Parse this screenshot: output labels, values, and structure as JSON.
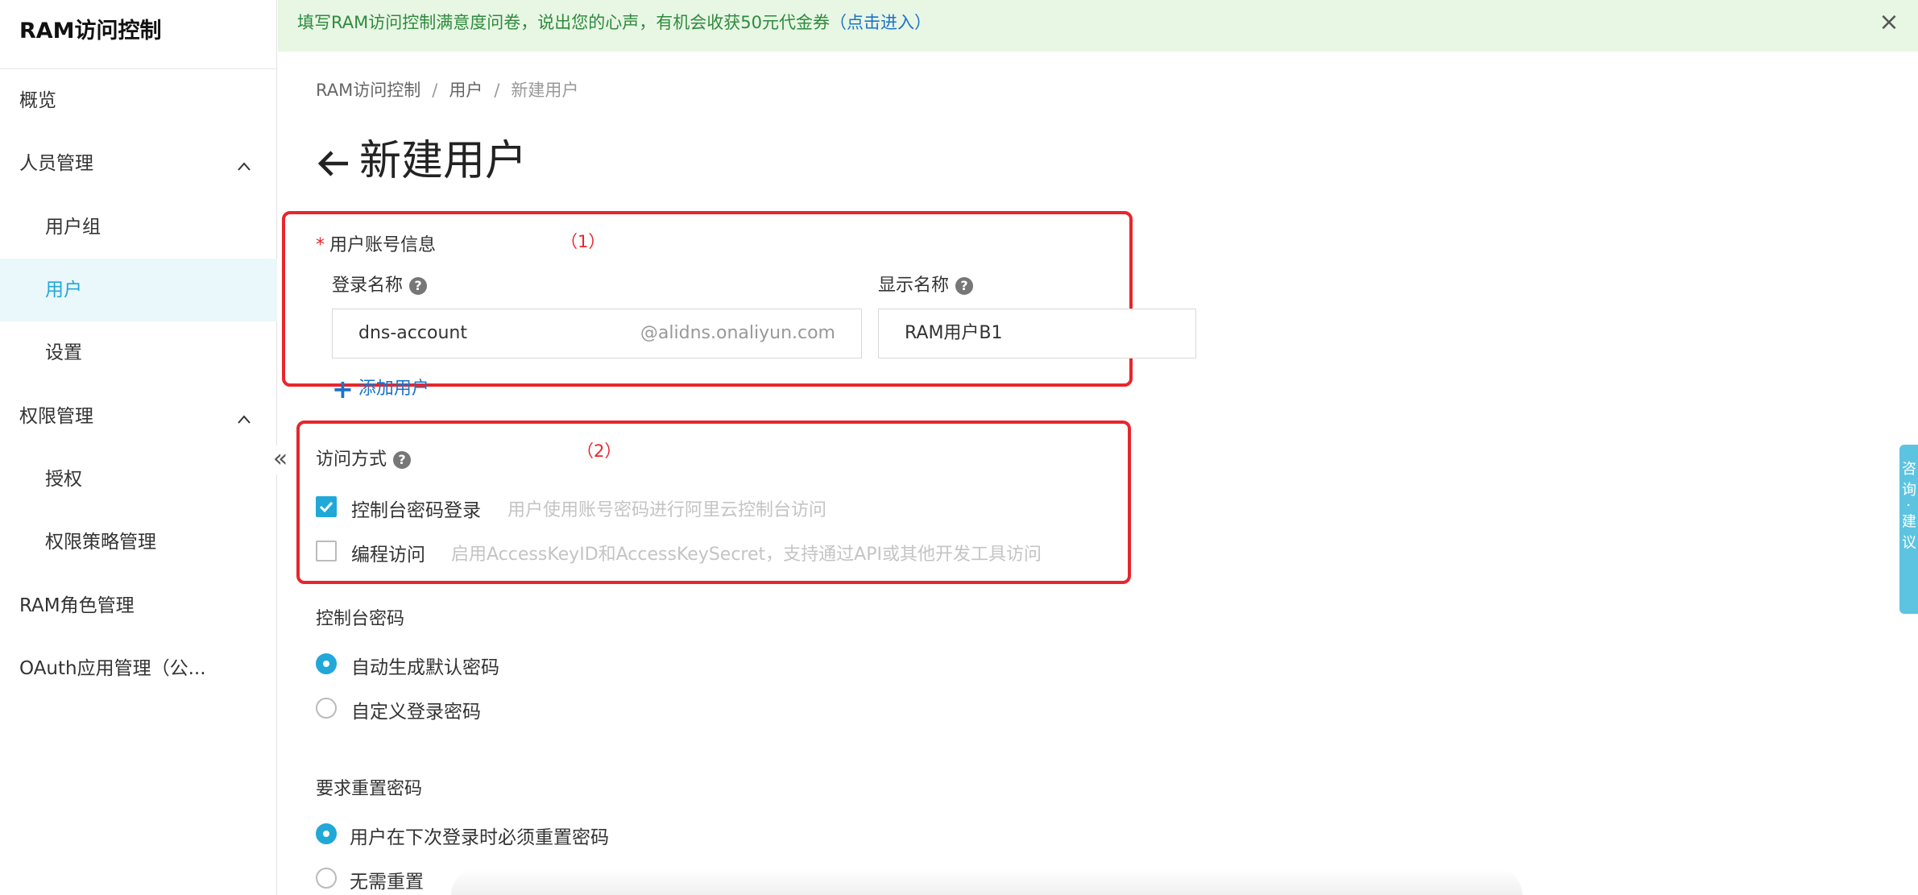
{
  "app": {
    "title": "RAM访问控制"
  },
  "sidebar": {
    "items": [
      {
        "label": "概览"
      },
      {
        "label": "人员管理"
      },
      {
        "label": "用户组"
      },
      {
        "label": "用户"
      },
      {
        "label": "设置"
      },
      {
        "label": "权限管理"
      },
      {
        "label": "授权"
      },
      {
        "label": "权限策略管理"
      },
      {
        "label": "RAM角色管理"
      },
      {
        "label": "OAuth应用管理（公..."
      }
    ],
    "collapse_glyph": "«"
  },
  "banner": {
    "text": "填写RAM访问控制满意度问卷，说出您的心声，有机会收获50元代金券",
    "link": "（点击进入）",
    "close": "×"
  },
  "breadcrumb": {
    "items": [
      "RAM访问控制",
      "用户",
      "新建用户"
    ],
    "sep": "/"
  },
  "page": {
    "title": "新建用户"
  },
  "account_info": {
    "label": "用户账号信息",
    "annotation": "（1）",
    "login_name_label": "登录名称",
    "display_name_label": "显示名称",
    "login_name_value": "dns-account",
    "login_name_suffix": "@alidns.onaliyun.com",
    "display_name_value": "RAM用户B1",
    "add_user": "添加用户"
  },
  "access": {
    "label": "访问方式",
    "annotation": "（2）",
    "console": {
      "label": "控制台密码登录",
      "hint": "用户使用账号密码进行阿里云控制台访问",
      "checked": true
    },
    "programmatic": {
      "label": "编程访问",
      "hint": "启用AccessKeyID和AccessKeySecret，支持通过API或其他开发工具访问",
      "checked": false
    }
  },
  "console_password": {
    "label": "控制台密码",
    "options": [
      {
        "label": "自动生成默认密码",
        "selected": true
      },
      {
        "label": "自定义登录密码",
        "selected": false
      }
    ]
  },
  "reset_password": {
    "label": "要求重置密码",
    "options": [
      {
        "label": "用户在下次登录时必须重置密码",
        "selected": true
      },
      {
        "label": "无需重置",
        "selected": false
      }
    ]
  },
  "feedback_tab": {
    "text": "咨询·建议"
  },
  "colors": {
    "accent": "#21a8d8",
    "annotation_red": "#e8262b",
    "banner_bg": "#e8f6e4",
    "link": "#1a73c9"
  }
}
